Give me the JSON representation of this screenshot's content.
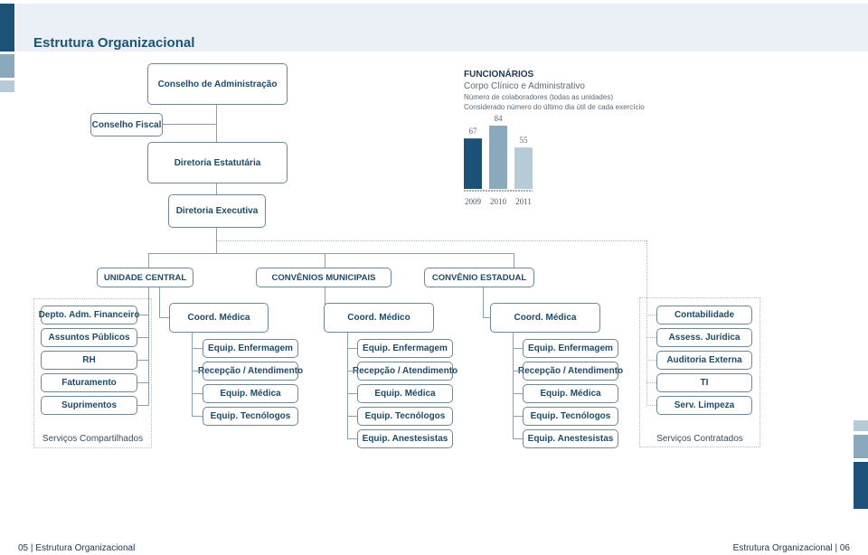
{
  "page": {
    "title": "Estrutura Organizacional",
    "footer_left": "05 | Estrutura Organizacional",
    "footer_right": "Estrutura Organizacional | 06"
  },
  "colors": {
    "dark_blue": "#1d5278",
    "mid_blue": "#8aa9bd",
    "light_blue": "#b7cbd6",
    "header_band": "#eaf0f5"
  },
  "org": {
    "conselho_admin": "Conselho de Administração",
    "conselho_fiscal": "Conselho Fiscal",
    "diretoria_estatutaria": "Diretoria Estatutária",
    "diretoria_executiva": "Diretoria Executiva",
    "units": [
      "UNIDADE CENTRAL",
      "CONVÊNIOS MUNICIPAIS",
      "CONVÊNIO ESTADUAL"
    ],
    "shared_services": {
      "label": "Serviços Compartilhados",
      "items": [
        "Depto. Adm. Financeiro",
        "Assuntos Públicos",
        "RH",
        "Faturamento",
        "Suprimentos"
      ]
    },
    "coord_central": {
      "title": "Coord. Médica",
      "items": [
        "Equip. Enfermagem",
        "Recepção / Atendimento",
        "Equip. Médica",
        "Equip. Tecnólogos"
      ]
    },
    "coord_municipais": {
      "title": "Coord. Médico",
      "items": [
        "Equip. Enfermagem",
        "Recepção / Atendimento",
        "Equip. Médica",
        "Equip. Tecnólogos",
        "Equip. Anestesistas"
      ]
    },
    "coord_estadual": {
      "title": "Coord. Médica",
      "items": [
        "Equip. Enfermagem",
        "Recepção / Atendimento",
        "Equip. Médica",
        "Equip. Tecnólogos",
        "Equip. Anestesistas"
      ]
    },
    "contracted_services": {
      "label": "Serviços Contratados",
      "items": [
        "Contabilidade",
        "Assess. Jurídica",
        "Auditoria Externa",
        "TI",
        "Serv. Limpeza"
      ]
    }
  },
  "chart_data": {
    "type": "bar",
    "title": "FUNCIONÁRIOS",
    "subtitle": "Corpo Clínico e Administrativo",
    "notes": [
      "Número de colaboradores (todas as unidades)",
      "Considerado número do último dia útil de cada exercício"
    ],
    "categories": [
      "2009",
      "2010",
      "2011"
    ],
    "values": [
      67,
      84,
      55
    ],
    "bar_colors": [
      "#1d5278",
      "#8aa9bd",
      "#b7cbd6"
    ],
    "xlabel": "",
    "ylabel": "",
    "ylim": [
      0,
      84
    ],
    "grid": false
  }
}
